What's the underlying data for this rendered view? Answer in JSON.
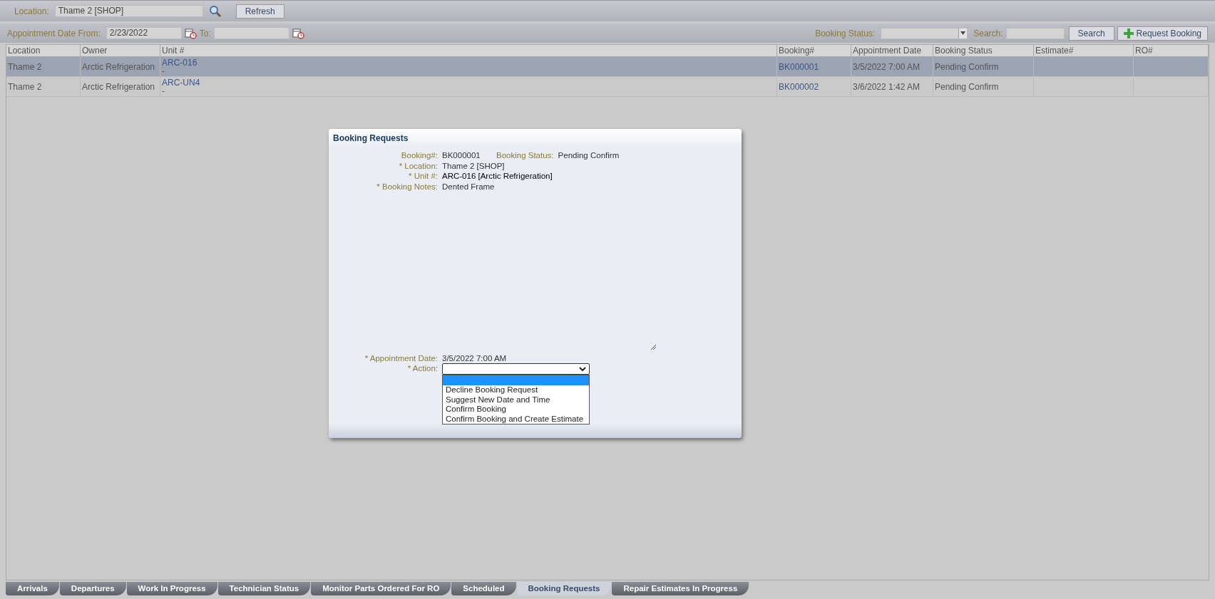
{
  "toolbar": {
    "location_label": "Location:",
    "location_value": "Thame 2 [SHOP]",
    "refresh": "Refresh"
  },
  "filters": {
    "from_label": "Appointment Date From:",
    "from_value": "2/23/2022",
    "to_label": "To:",
    "status_label": "Booking Status:",
    "search_label": "Search:",
    "search_button": "Search",
    "request_button": "Request Booking"
  },
  "table": {
    "columns": [
      "Location",
      "Owner",
      "Unit #",
      "Booking#",
      "Appointment Date",
      "Booking Status",
      "Estimate#",
      "RO#"
    ],
    "rows": [
      {
        "selected": true,
        "location": "Thame 2",
        "owner": "Arctic Refrigeration",
        "unit": "ARC-016",
        "unit_sub": "-",
        "booking": "BK000001",
        "date": "3/5/2022 7:00 AM",
        "status": "Pending Confirm"
      },
      {
        "selected": false,
        "location": "Thame 2",
        "owner": "Arctic Refrigeration",
        "unit": "ARC-UN4",
        "unit_sub": "-",
        "booking": "BK000002",
        "date": "3/6/2022 1:42 AM",
        "status": "Pending Confirm"
      }
    ]
  },
  "dialog": {
    "title": "Booking Requests",
    "booking_label": "Booking#:",
    "booking_value": "BK000001",
    "status_label": "Booking Status:",
    "status_value": "Pending Confirm",
    "fields": [
      {
        "label": "* Location:",
        "value": "Thame 2 [SHOP]",
        "kind": "plain"
      },
      {
        "label": "* Unit #:",
        "value": "ARC-016 [Arctic Refrigeration]",
        "kind": "strong"
      },
      {
        "label": "* Booking Notes:",
        "value": "Dented Frame",
        "kind": "notes"
      }
    ],
    "date_label": "* Appointment Date:",
    "date_value": "3/5/2022 7:00 AM",
    "action_label": "* Action:",
    "action_open": true,
    "blank_option_selected": true,
    "action_options": [
      {
        "label": "Decline Booking Request",
        "selected": false
      },
      {
        "label": "Suggest New Date and Time",
        "selected": false
      },
      {
        "label": "Confirm Booking",
        "selected": false
      },
      {
        "label": "Confirm Booking and Create Estimate",
        "selected": false
      }
    ]
  },
  "tabs": [
    {
      "label": "Arrivals",
      "selected": false
    },
    {
      "label": "Departures",
      "selected": false
    },
    {
      "label": "Work In Progress",
      "selected": false
    },
    {
      "label": "Technician Status",
      "selected": false
    },
    {
      "label": "Monitor Parts Ordered For RO",
      "selected": false
    },
    {
      "label": "Scheduled",
      "selected": false
    },
    {
      "label": "Booking Requests",
      "selected": true
    },
    {
      "label": "Repair Estimates In Progress",
      "selected": false
    }
  ]
}
